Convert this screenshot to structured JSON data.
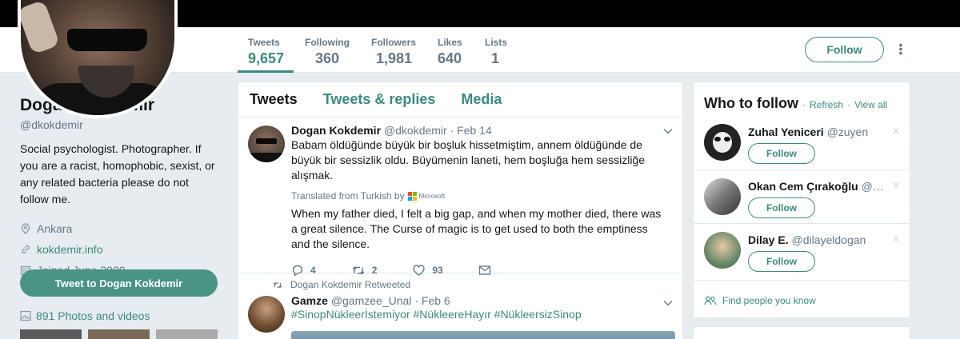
{
  "nav": {
    "stats": [
      {
        "label": "Tweets",
        "value": "9,657"
      },
      {
        "label": "Following",
        "value": "360"
      },
      {
        "label": "Followers",
        "value": "1,981"
      },
      {
        "label": "Likes",
        "value": "640"
      },
      {
        "label": "Lists",
        "value": "1"
      }
    ],
    "follow_label": "Follow"
  },
  "profile": {
    "name": "Dogan Kokdemir",
    "handle": "@dkokdemir",
    "bio": "Social psychologist. Photographer. If you are a racist, homophobic, sexist, or any related bacteria please do not follow me.",
    "location": "Ankara",
    "website": "kokdemir.info",
    "joined": "Joined June 2009",
    "tweet_to_label": "Tweet to Dogan Kokdemir",
    "photos_label": "891 Photos and videos"
  },
  "timeline": {
    "tabs": [
      "Tweets",
      "Tweets & replies",
      "Media"
    ],
    "tweets": [
      {
        "name": "Dogan Kokdemir",
        "handle": "@dkokdemir",
        "date": "· Feb 14",
        "text": "Babam öldüğünde büyük bir boşluk hissetmiştim, annem öldüğünde de büyük bir sessizlik oldu. Büyümenin laneti, hem boşluğa hem sessizliğe alışmak.",
        "translated_label": "Translated from Turkish by",
        "translator": "Microsoft",
        "translation": "When my father died, I felt a big gap, and when my mother died, there was a great silence. The Curse of magic is to get used to both the emptiness and the silence.",
        "replies": "4",
        "retweets": "2",
        "likes": "93"
      },
      {
        "retweeted_by": "Dogan Kokdemir Retweeted",
        "name": "Gamze",
        "handle": "@gamzee_Unal",
        "date": "· Feb 6",
        "text": "#SinopNükleerİstemiyor #NükleereHayır #NükleersizSinop"
      }
    ]
  },
  "who_to_follow": {
    "title": "Who to follow",
    "refresh": "Refresh",
    "view_all": "View all",
    "suggestions": [
      {
        "name": "Zuhal Yeniceri",
        "handle": "@zuyen",
        "button": "Follow"
      },
      {
        "name": "Okan Cem Çırakoğlu",
        "handle": "@o...",
        "button": "Follow"
      },
      {
        "name": "Dilay E.",
        "handle": "@dilayeldogan",
        "button": "Follow"
      }
    ],
    "find_people": "Find people you know"
  },
  "colors": {
    "accent": "#3b8a7e",
    "secondary_text": "#657786",
    "page_bg": "#e6ecf0"
  }
}
